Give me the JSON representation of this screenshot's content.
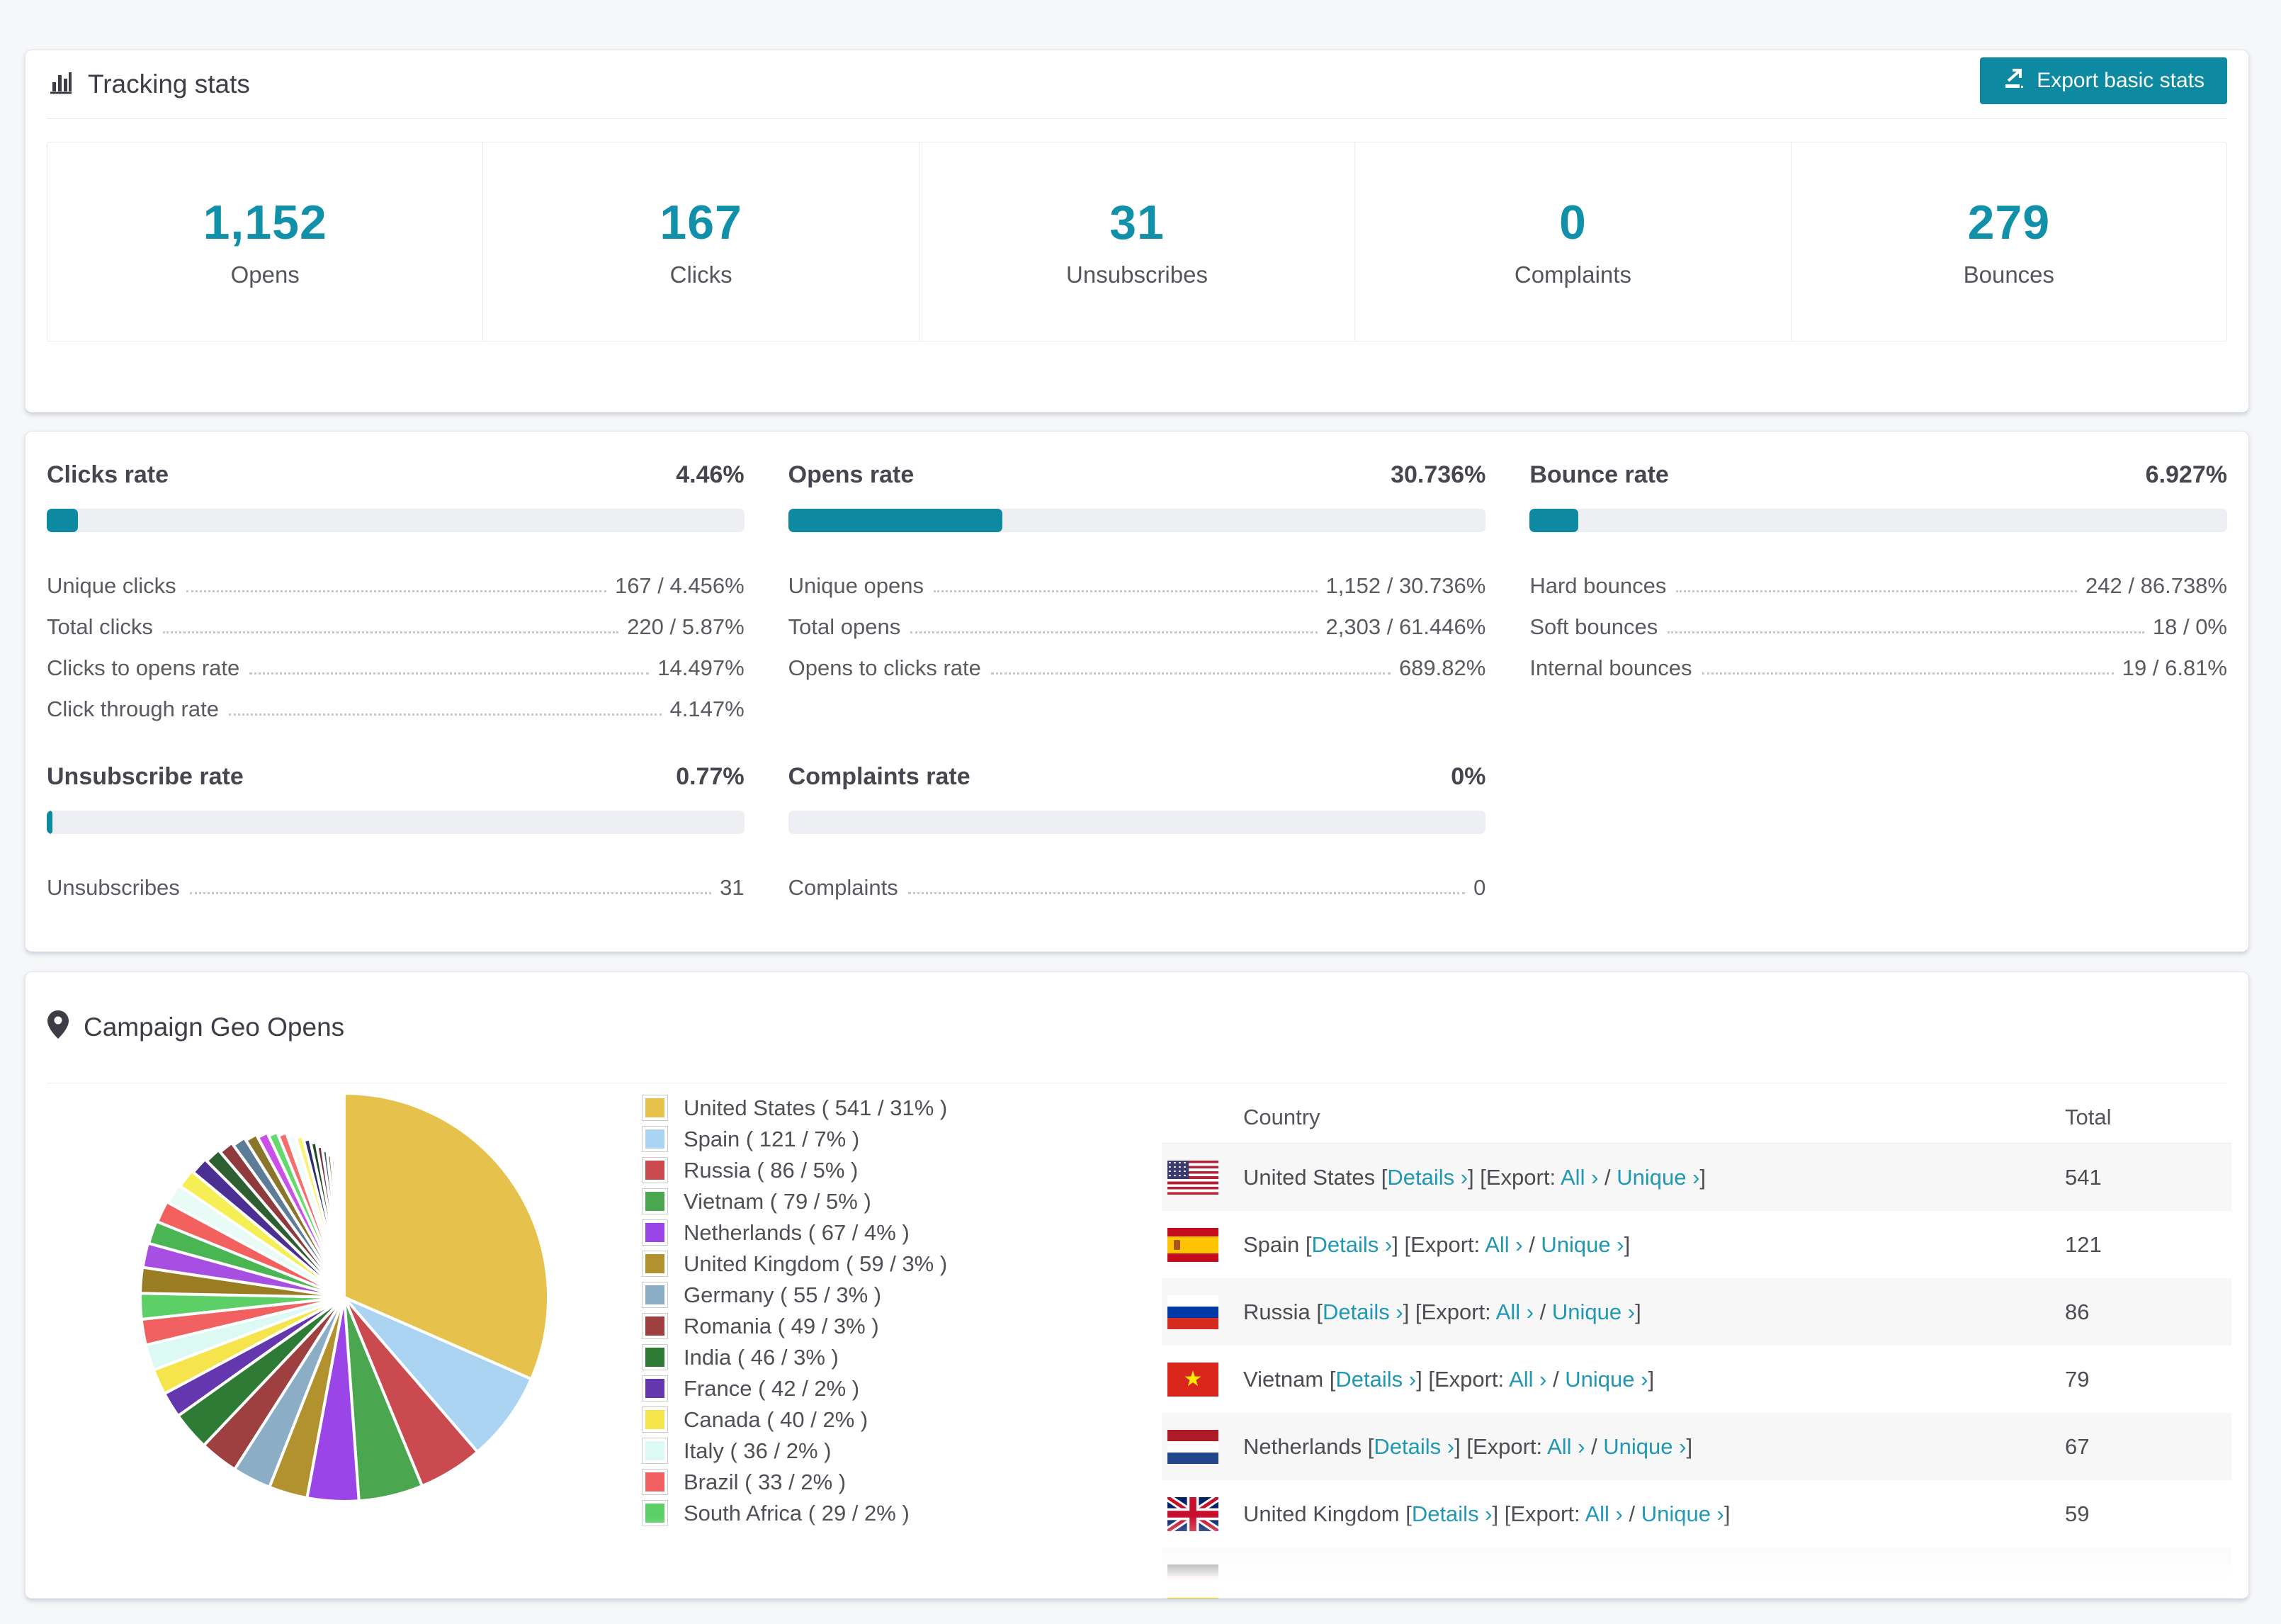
{
  "tracking": {
    "title": "Tracking stats",
    "export_button": "Export basic stats",
    "stats": [
      {
        "value": "1,152",
        "label": "Opens"
      },
      {
        "value": "167",
        "label": "Clicks"
      },
      {
        "value": "31",
        "label": "Unsubscribes"
      },
      {
        "value": "0",
        "label": "Complaints"
      },
      {
        "value": "279",
        "label": "Bounces"
      }
    ]
  },
  "rates": {
    "blocks": [
      {
        "id": "clicks",
        "title": "Clicks rate",
        "value": "4.46%",
        "percent": 4.46,
        "rows": [
          {
            "label": "Unique clicks",
            "value": "167 / 4.456%"
          },
          {
            "label": "Total clicks",
            "value": "220 / 5.87%"
          },
          {
            "label": "Clicks to opens rate",
            "value": "14.497%"
          },
          {
            "label": "Click through rate",
            "value": "4.147%"
          }
        ]
      },
      {
        "id": "opens",
        "title": "Opens rate",
        "value": "30.736%",
        "percent": 30.736,
        "rows": [
          {
            "label": "Unique opens",
            "value": "1,152 / 30.736%"
          },
          {
            "label": "Total opens",
            "value": "2,303 / 61.446%"
          },
          {
            "label": "Opens to clicks rate",
            "value": "689.82%"
          }
        ]
      },
      {
        "id": "bounce",
        "title": "Bounce rate",
        "value": "6.927%",
        "percent": 6.927,
        "rows": [
          {
            "label": "Hard bounces",
            "value": "242 / 86.738%"
          },
          {
            "label": "Soft bounces",
            "value": "18 / 0%"
          },
          {
            "label": "Internal bounces",
            "value": "19 / 6.81%"
          }
        ]
      },
      {
        "id": "unsubscribe",
        "title": "Unsubscribe rate",
        "value": "0.77%",
        "percent": 0.77,
        "rows": [
          {
            "label": "Unsubscribes",
            "value": "31"
          }
        ]
      },
      {
        "id": "complaints",
        "title": "Complaints rate",
        "value": "0%",
        "percent": 0,
        "rows": [
          {
            "label": "Complaints",
            "value": "0"
          }
        ]
      }
    ]
  },
  "geo": {
    "title": "Campaign Geo Opens",
    "columns": {
      "country": "Country",
      "total": "Total"
    },
    "link_labels": {
      "details": "Details ›",
      "export_prefix": "Export:",
      "all": "All ›",
      "unique": "Unique ›",
      "slash": " / "
    },
    "table_rows": [
      {
        "flag": "us",
        "country": "United States",
        "total": "541"
      },
      {
        "flag": "es",
        "country": "Spain",
        "total": "121"
      },
      {
        "flag": "ru",
        "country": "Russia",
        "total": "86"
      },
      {
        "flag": "vn",
        "country": "Vietnam",
        "total": "79"
      },
      {
        "flag": "nl",
        "country": "Netherlands",
        "total": "67"
      },
      {
        "flag": "gb",
        "country": "United Kingdom",
        "total": "59"
      }
    ],
    "partial_row": {
      "flag": "de"
    }
  },
  "chart_data": {
    "type": "pie",
    "title": "Campaign Geo Opens",
    "legend_position": "right",
    "slices": [
      {
        "label": "United States",
        "count": 541,
        "percent": 31,
        "color": "#e6c14b"
      },
      {
        "label": "Spain",
        "count": 121,
        "percent": 7,
        "color": "#abd4f2"
      },
      {
        "label": "Russia",
        "count": 86,
        "percent": 5,
        "color": "#ca4a50"
      },
      {
        "label": "Vietnam",
        "count": 79,
        "percent": 5,
        "color": "#4aa750"
      },
      {
        "label": "Netherlands",
        "count": 67,
        "percent": 4,
        "color": "#9b44e8"
      },
      {
        "label": "United Kingdom",
        "count": 59,
        "percent": 3,
        "color": "#b2922f"
      },
      {
        "label": "Germany",
        "count": 55,
        "percent": 3,
        "color": "#8badc6"
      },
      {
        "label": "Romania",
        "count": 49,
        "percent": 3,
        "color": "#9e4040"
      },
      {
        "label": "India",
        "count": 46,
        "percent": 3,
        "color": "#2e7b36"
      },
      {
        "label": "France",
        "count": 42,
        "percent": 2,
        "color": "#6437af"
      },
      {
        "label": "Canada",
        "count": 40,
        "percent": 2,
        "color": "#f6e44c"
      },
      {
        "label": "Italy",
        "count": 36,
        "percent": 2,
        "color": "#dcf9f3"
      },
      {
        "label": "Brazil",
        "count": 33,
        "percent": 2,
        "color": "#f16161"
      },
      {
        "label": "South Africa",
        "count": 29,
        "percent": 2,
        "color": "#5ccf67"
      }
    ],
    "other_slices": {
      "note": "unlabeled small countries",
      "percents": [
        2.0,
        1.9,
        1.8,
        1.7,
        1.6,
        1.5,
        1.4,
        1.3,
        1.2,
        1.1,
        1.0,
        0.9,
        0.8,
        0.75,
        0.7,
        0.65,
        0.6,
        0.55,
        0.5,
        0.45,
        0.4,
        0.35,
        0.3,
        0.25,
        0.2,
        0.15,
        0.1,
        0.1
      ],
      "colors": [
        "#9a7d22",
        "#a84fe3",
        "#4ab553",
        "#f2615e",
        "#e8fbf7",
        "#f6ee55",
        "#4b2f92",
        "#2d5f33",
        "#8f3a3c",
        "#5d7c97",
        "#8b742b",
        "#cb50e9",
        "#64da6e",
        "#f46f6c",
        "#f4fcfb",
        "#f8f279",
        "#2c2e74",
        "#1e4b28",
        "#703031",
        "#405b72",
        "#6d5b20",
        "#d351f1",
        "#a9ceed",
        "#e15554",
        "#41af4e",
        "#8c4ce2",
        "#cba62f",
        "#e9e94d"
      ]
    }
  },
  "colors": {
    "accent": "#0d89a1",
    "link": "#2097b3",
    "stat_number": "#1090a9"
  }
}
